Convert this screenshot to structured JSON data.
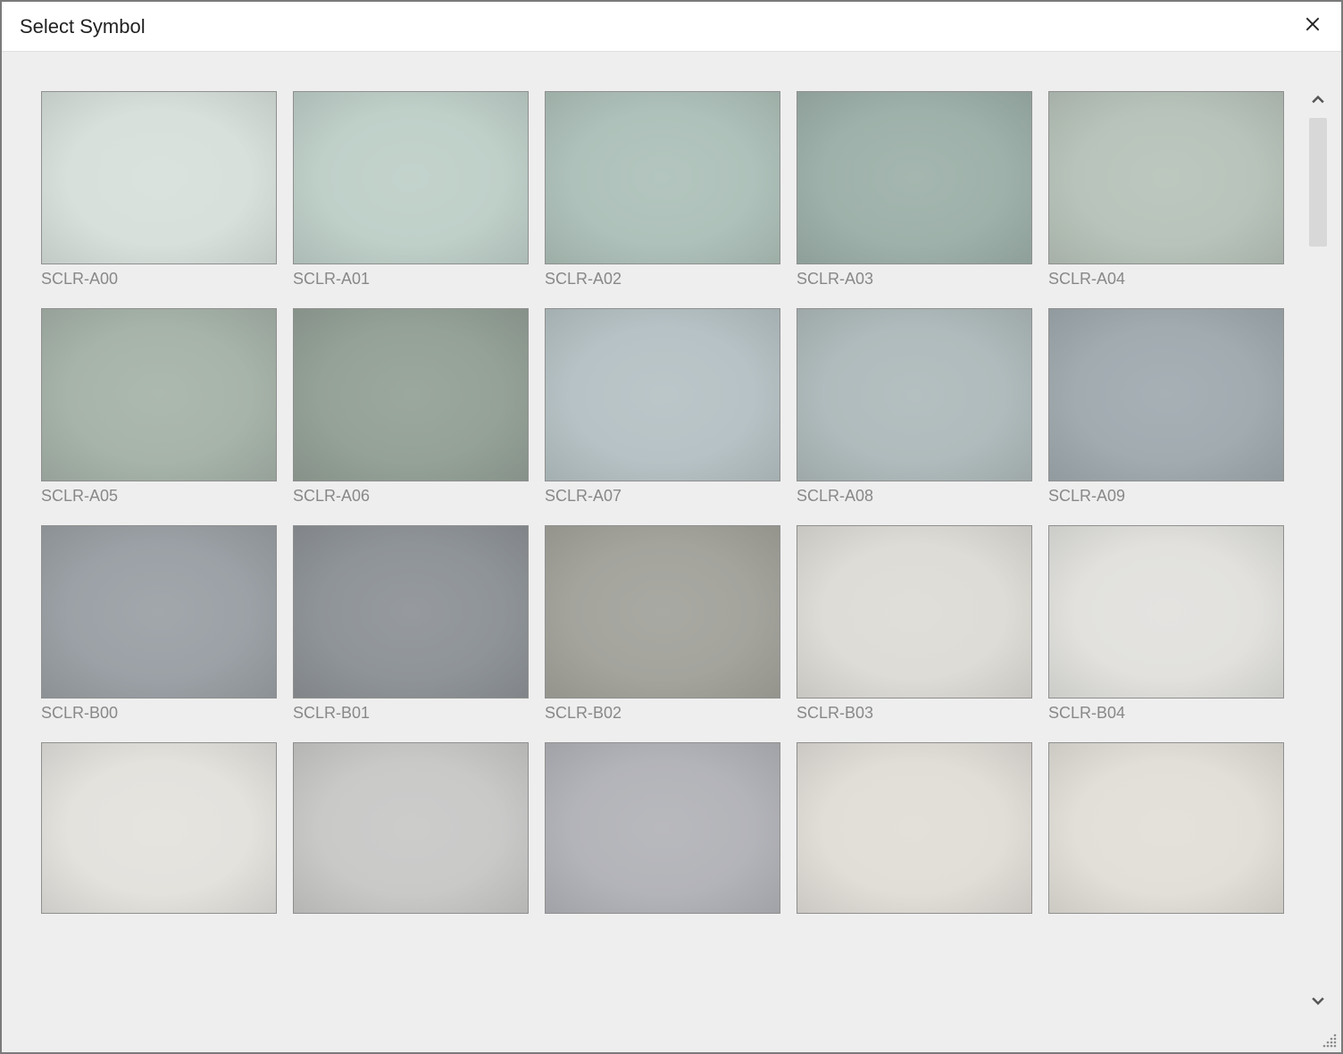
{
  "window": {
    "title": "Select Symbol"
  },
  "swatches": [
    {
      "label": "SCLR-A00",
      "color": "#d8e0dc"
    },
    {
      "label": "SCLR-A01",
      "color": "#bfd0c9"
    },
    {
      "label": "SCLR-A02",
      "color": "#aec1ba"
    },
    {
      "label": "SCLR-A03",
      "color": "#9eb1aa"
    },
    {
      "label": "SCLR-A04",
      "color": "#b8c4bb"
    },
    {
      "label": "SCLR-A05",
      "color": "#a7b4aa"
    },
    {
      "label": "SCLR-A06",
      "color": "#95a298"
    },
    {
      "label": "SCLR-A07",
      "color": "#b6c2c5"
    },
    {
      "label": "SCLR-A08",
      "color": "#afbbbc"
    },
    {
      "label": "SCLR-A09",
      "color": "#a1abb0"
    },
    {
      "label": "SCLR-B00",
      "color": "#9ba1a6"
    },
    {
      "label": "SCLR-B01",
      "color": "#8f9498"
    },
    {
      "label": "SCLR-B02",
      "color": "#a4a49d"
    },
    {
      "label": "SCLR-B03",
      "color": "#dedcd6"
    },
    {
      "label": "SCLR-B04",
      "color": "#e2e1de"
    },
    {
      "label": "",
      "color": "#e4e2dd"
    },
    {
      "label": "",
      "color": "#c9c9c8"
    },
    {
      "label": "",
      "color": "#b3b4b9"
    },
    {
      "label": "",
      "color": "#e1ddd7"
    },
    {
      "label": "",
      "color": "#e2dfd8"
    }
  ]
}
